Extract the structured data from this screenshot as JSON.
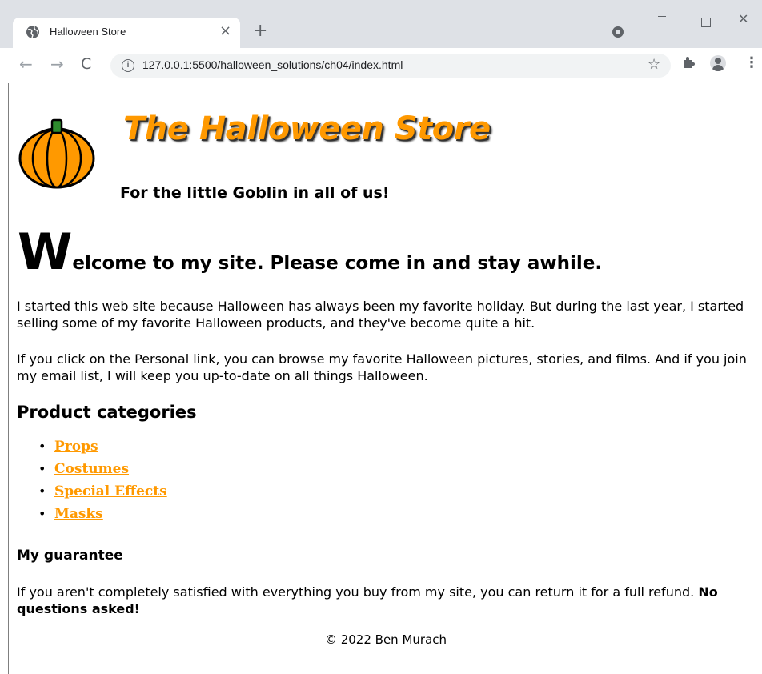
{
  "browser": {
    "tab_title": "Halloween Store",
    "tab_close": "×",
    "new_tab": "+",
    "url": "127.0.0.1:5500/halloween_solutions/ch04/index.html"
  },
  "header": {
    "title": "The Halloween Store",
    "tagline": "For the little Goblin in all of us!"
  },
  "main": {
    "welcome_dropcap": "W",
    "welcome_rest": "elcome to my site. Please come in and stay awhile.",
    "para1": "I started this web site because Halloween has always been my favorite holiday. But during the last year, I started selling some of my favorite Halloween products, and they've become quite a hit.",
    "para2": "If you click on the Personal link, you can browse my favorite Halloween pictures, stories, and films. And if you join my email list, I will keep you up-to-date on all things Halloween.",
    "categories_heading": "Product categories",
    "categories": [
      "Props",
      "Costumes",
      "Special Effects",
      "Masks"
    ],
    "guarantee_heading": "My guarantee",
    "guarantee_text": "If you aren't completely satisfied with everything you buy from my site, you can return it for a full refund.",
    "guarantee_bold": "No questions asked!"
  },
  "footer": {
    "copyright": "© 2022 Ben Murach"
  },
  "colors": {
    "accent": "#ff9900",
    "link": "#ff9900"
  }
}
